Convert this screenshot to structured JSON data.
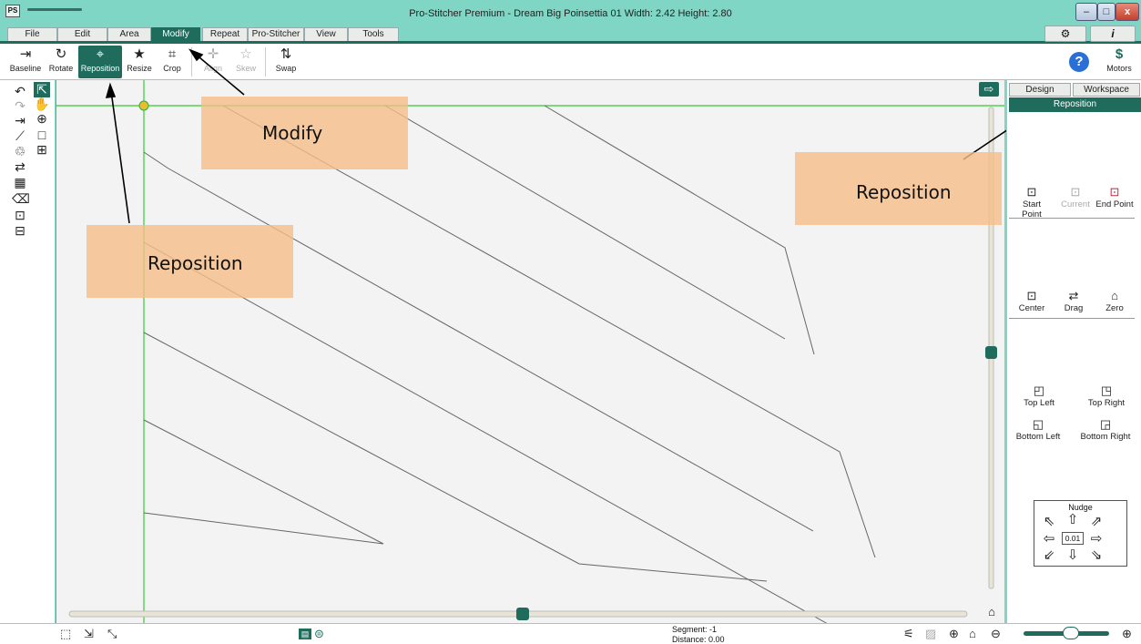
{
  "window": {
    "app_icon": "PS",
    "title": "Pro-Stitcher Premium  -  Dream Big Poinsettia 01  Width: 2.42  Height: 2.80",
    "min_label": "–",
    "max_label": "□",
    "close_label": "x"
  },
  "menu": {
    "tabs": [
      "File",
      "Edit",
      "Area",
      "Modify",
      "Repeat",
      "Pro-Stitcher",
      "View",
      "Tools"
    ],
    "active": "Modify",
    "settings_icon": "gear-icon",
    "info_label": "i"
  },
  "toolbar": {
    "items": [
      {
        "label": "Baseline",
        "icon": "baseline-icon"
      },
      {
        "label": "Rotate",
        "icon": "rotate-icon"
      },
      {
        "label": "Reposition",
        "icon": "reposition-icon",
        "selected": true
      },
      {
        "label": "Resize",
        "icon": "resize-icon"
      },
      {
        "label": "Crop",
        "icon": "crop-icon"
      },
      {
        "label": "Align",
        "icon": "align-icon",
        "disabled": true
      },
      {
        "label": "Skew",
        "icon": "skew-icon",
        "disabled": true
      },
      {
        "label": "Swap",
        "icon": "swap-icon"
      }
    ],
    "help_icon": "help-icon",
    "motors_label": "Motors"
  },
  "right_panel": {
    "tabs": [
      "Design",
      "Workspace"
    ],
    "title": "Reposition",
    "point_buttons": [
      "Start Point",
      "Current",
      "End Point"
    ],
    "position_buttons": [
      "Center",
      "Drag",
      "Zero"
    ],
    "corner_buttons": [
      "Top Left",
      "Top Right",
      "Bottom Left",
      "Bottom Right"
    ],
    "nudge_label": "Nudge",
    "nudge_value": "0.01"
  },
  "status": {
    "segment": "Segment: -1",
    "distance": "Distance: 0.00"
  },
  "annotations": {
    "modify": "Modify",
    "reposition_left": "Reposition",
    "reposition_right": "Reposition"
  },
  "colors": {
    "accent": "#1f6b5c",
    "title_bar": "#7fd6c4",
    "guide_line": "#33cc33",
    "note_fill": "#f5be87"
  }
}
